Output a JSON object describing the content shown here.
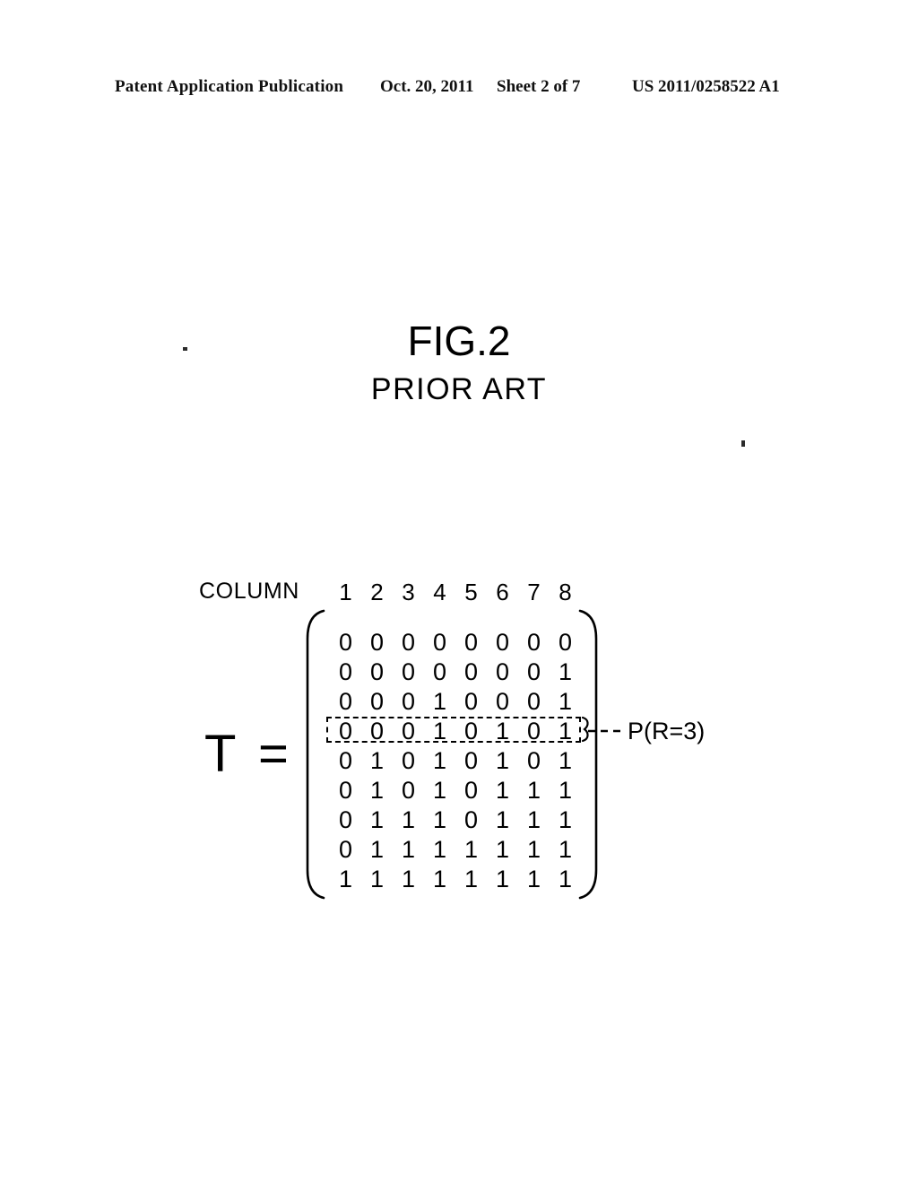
{
  "header": {
    "publication": "Patent Application Publication",
    "date": "Oct. 20, 2011",
    "sheet": "Sheet 2 of 7",
    "patent_number": "US 2011/0258522 A1"
  },
  "figure": {
    "number": "FIG.2",
    "subtitle": "PRIOR ART"
  },
  "matrix": {
    "axis_label": "COLUMN",
    "name": "T",
    "equals": "=",
    "column_headers": [
      "1",
      "2",
      "3",
      "4",
      "5",
      "6",
      "7",
      "8"
    ],
    "rows": [
      [
        "0",
        "0",
        "0",
        "0",
        "0",
        "0",
        "0",
        "0"
      ],
      [
        "0",
        "0",
        "0",
        "0",
        "0",
        "0",
        "0",
        "1"
      ],
      [
        "0",
        "0",
        "0",
        "1",
        "0",
        "0",
        "0",
        "1"
      ],
      [
        "0",
        "0",
        "0",
        "1",
        "0",
        "1",
        "0",
        "1"
      ],
      [
        "0",
        "1",
        "0",
        "1",
        "0",
        "1",
        "0",
        "1"
      ],
      [
        "0",
        "1",
        "0",
        "1",
        "0",
        "1",
        "1",
        "1"
      ],
      [
        "0",
        "1",
        "1",
        "1",
        "0",
        "1",
        "1",
        "1"
      ],
      [
        "0",
        "1",
        "1",
        "1",
        "1",
        "1",
        "1",
        "1"
      ],
      [
        "1",
        "1",
        "1",
        "1",
        "1",
        "1",
        "1",
        "1"
      ]
    ],
    "highlighted_row_index": 3,
    "callout_label": "P(R=3)"
  },
  "colors": {
    "ink": "#000000",
    "background": "#ffffff"
  }
}
